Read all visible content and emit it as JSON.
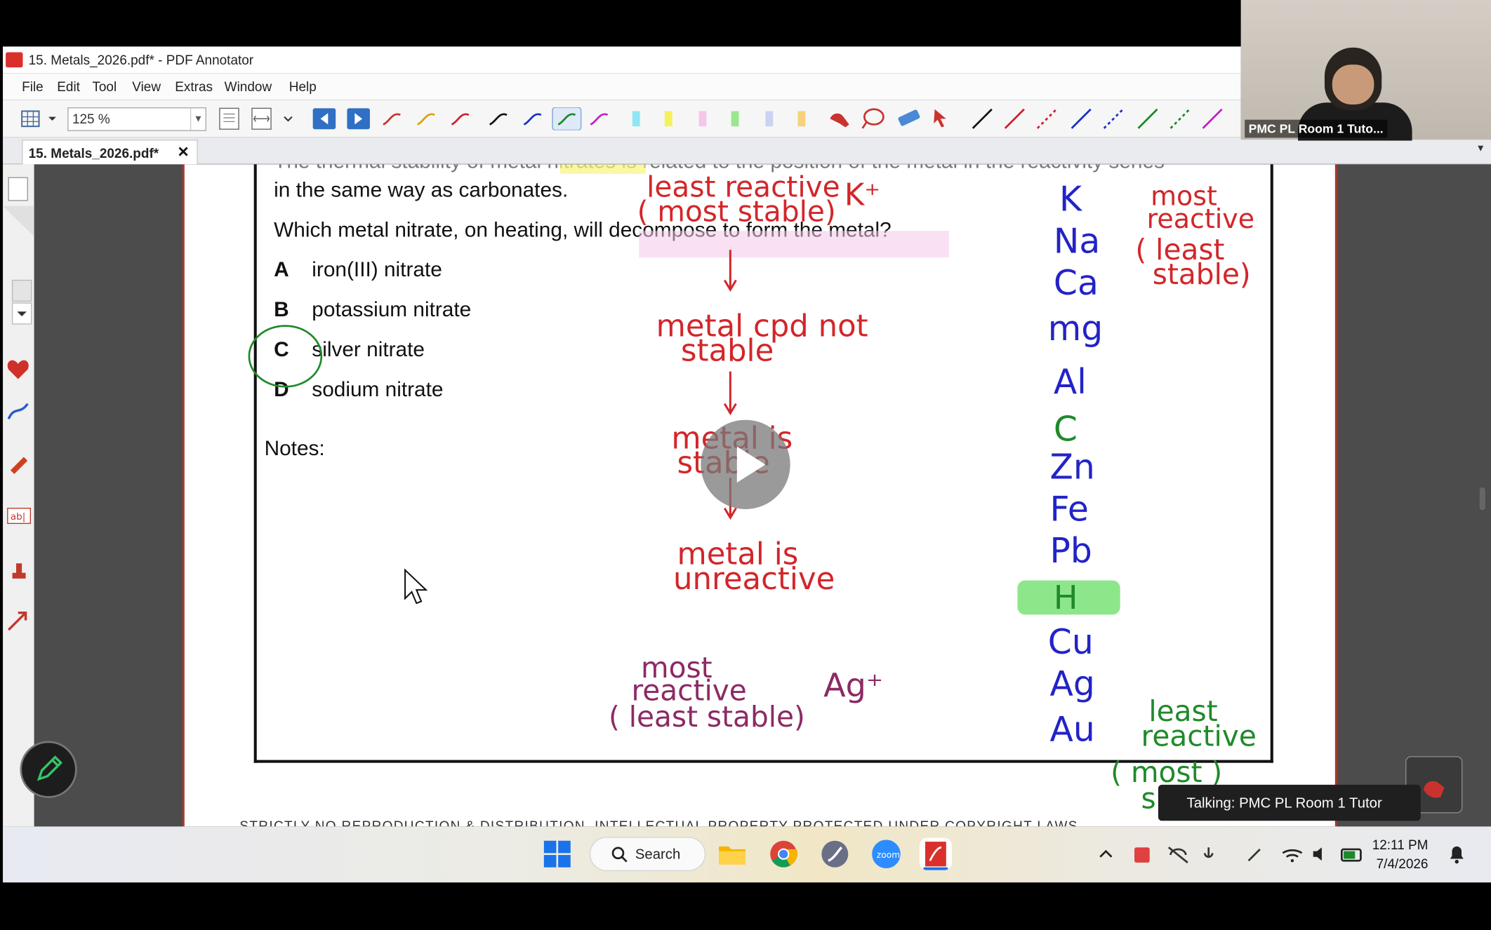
{
  "window": {
    "title": "15. Metals_2026.pdf* - PDF Annotator"
  },
  "menu": [
    "File",
    "Edit",
    "Tool",
    "View",
    "Extras",
    "Window",
    "Help"
  ],
  "toolbar": {
    "zoom": "125 %"
  },
  "tab": {
    "label": "15. Metals_2026.pdf*",
    "close": "✕",
    "menu": "▼"
  },
  "question": {
    "line0": "The thermal stability of metal nitrates is related to the position of the metal in the reactivity series",
    "line1": "in the same way as carbonates.",
    "line2": "Which metal nitrate, on heating, will decompose to form the metal?",
    "options": [
      {
        "letter": "A",
        "text": "iron(III) nitrate"
      },
      {
        "letter": "B",
        "text": "potassium nitrate"
      },
      {
        "letter": "C",
        "text": "silver nitrate"
      },
      {
        "letter": "D",
        "text": "sodium nitrate"
      }
    ],
    "notes": "Notes:"
  },
  "handwriting": {
    "least_reactive_1": "least reactive",
    "most_stable_1": "( most stable)",
    "k_ion": "K⁺",
    "metal_cpd_1": "metal cpd not",
    "metal_cpd_2": "stable",
    "metal_is_1": "metal is",
    "metal_is_2": "stable",
    "metal_un_1": "metal is",
    "metal_un_2": "unreactive",
    "most_reactive_b1": "most",
    "most_reactive_b2": "reactive",
    "least_stable_b": "( least stable)",
    "ag_ion": "Ag⁺",
    "most_r1": "most",
    "most_r2": "reactive",
    "least_s1": "( least",
    "least_s2": "stable)",
    "least_r1": "least",
    "least_r2": "reactive",
    "most_s1": "( most )",
    "most_s2": "s"
  },
  "series": [
    "K",
    "Na",
    "Ca",
    "mg",
    "Al",
    "C",
    "Zn",
    "Fe",
    "Pb",
    "H",
    "Cu",
    "Ag",
    "Au"
  ],
  "footer": "STRICTLY NO REPRODUCTION & DISTRIBUTION. INTELLECTUAL PROPERTY PROTECTED UNDER COPYRIGHT LAWS",
  "video": {
    "name": "PMC PL Room 1 Tuto..."
  },
  "talking": "Talking: PMC PL Room 1 Tutor",
  "taskbar": {
    "search": "Search",
    "time": "12:11 PM",
    "date": "7/4/2026"
  },
  "colors": {
    "red": "#d2262a",
    "blue": "#2323c8",
    "green": "#1f8a2a",
    "highlight": "#8ee68a"
  }
}
